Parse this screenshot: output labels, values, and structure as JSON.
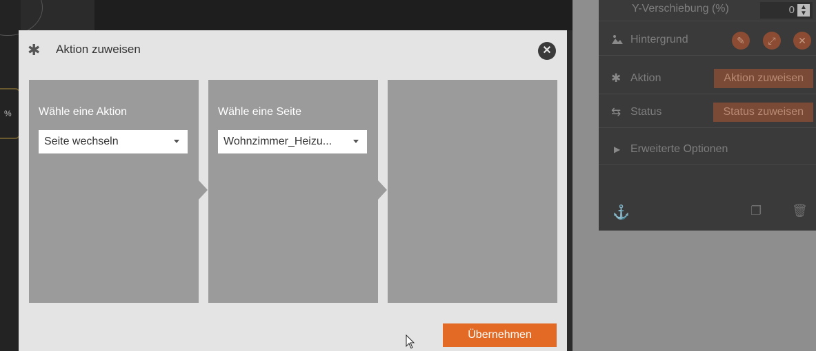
{
  "modal": {
    "title": "Aktion zuweisen",
    "columns": [
      {
        "label": "Wähle eine Aktion",
        "selected": "Seite wechseln"
      },
      {
        "label": "Wähle eine Seite",
        "selected": "Wohnzimmer_Heizu..."
      },
      {
        "label": "",
        "selected": ""
      }
    ],
    "apply_label": "Übernehmen"
  },
  "canvas": {
    "pct_text": "%"
  },
  "inspector": {
    "y_shift": {
      "label": "Y-Verschiebung (%)",
      "value": "0"
    },
    "background": {
      "label": "Hintergrund"
    },
    "action": {
      "label": "Aktion",
      "button": "Aktion zuweisen"
    },
    "status": {
      "label": "Status",
      "button": "Status zuweisen"
    },
    "advanced": {
      "label": "Erweiterte Optionen"
    }
  },
  "colors": {
    "accent": "#e36a24",
    "inspector_button": "#7a4a36"
  }
}
